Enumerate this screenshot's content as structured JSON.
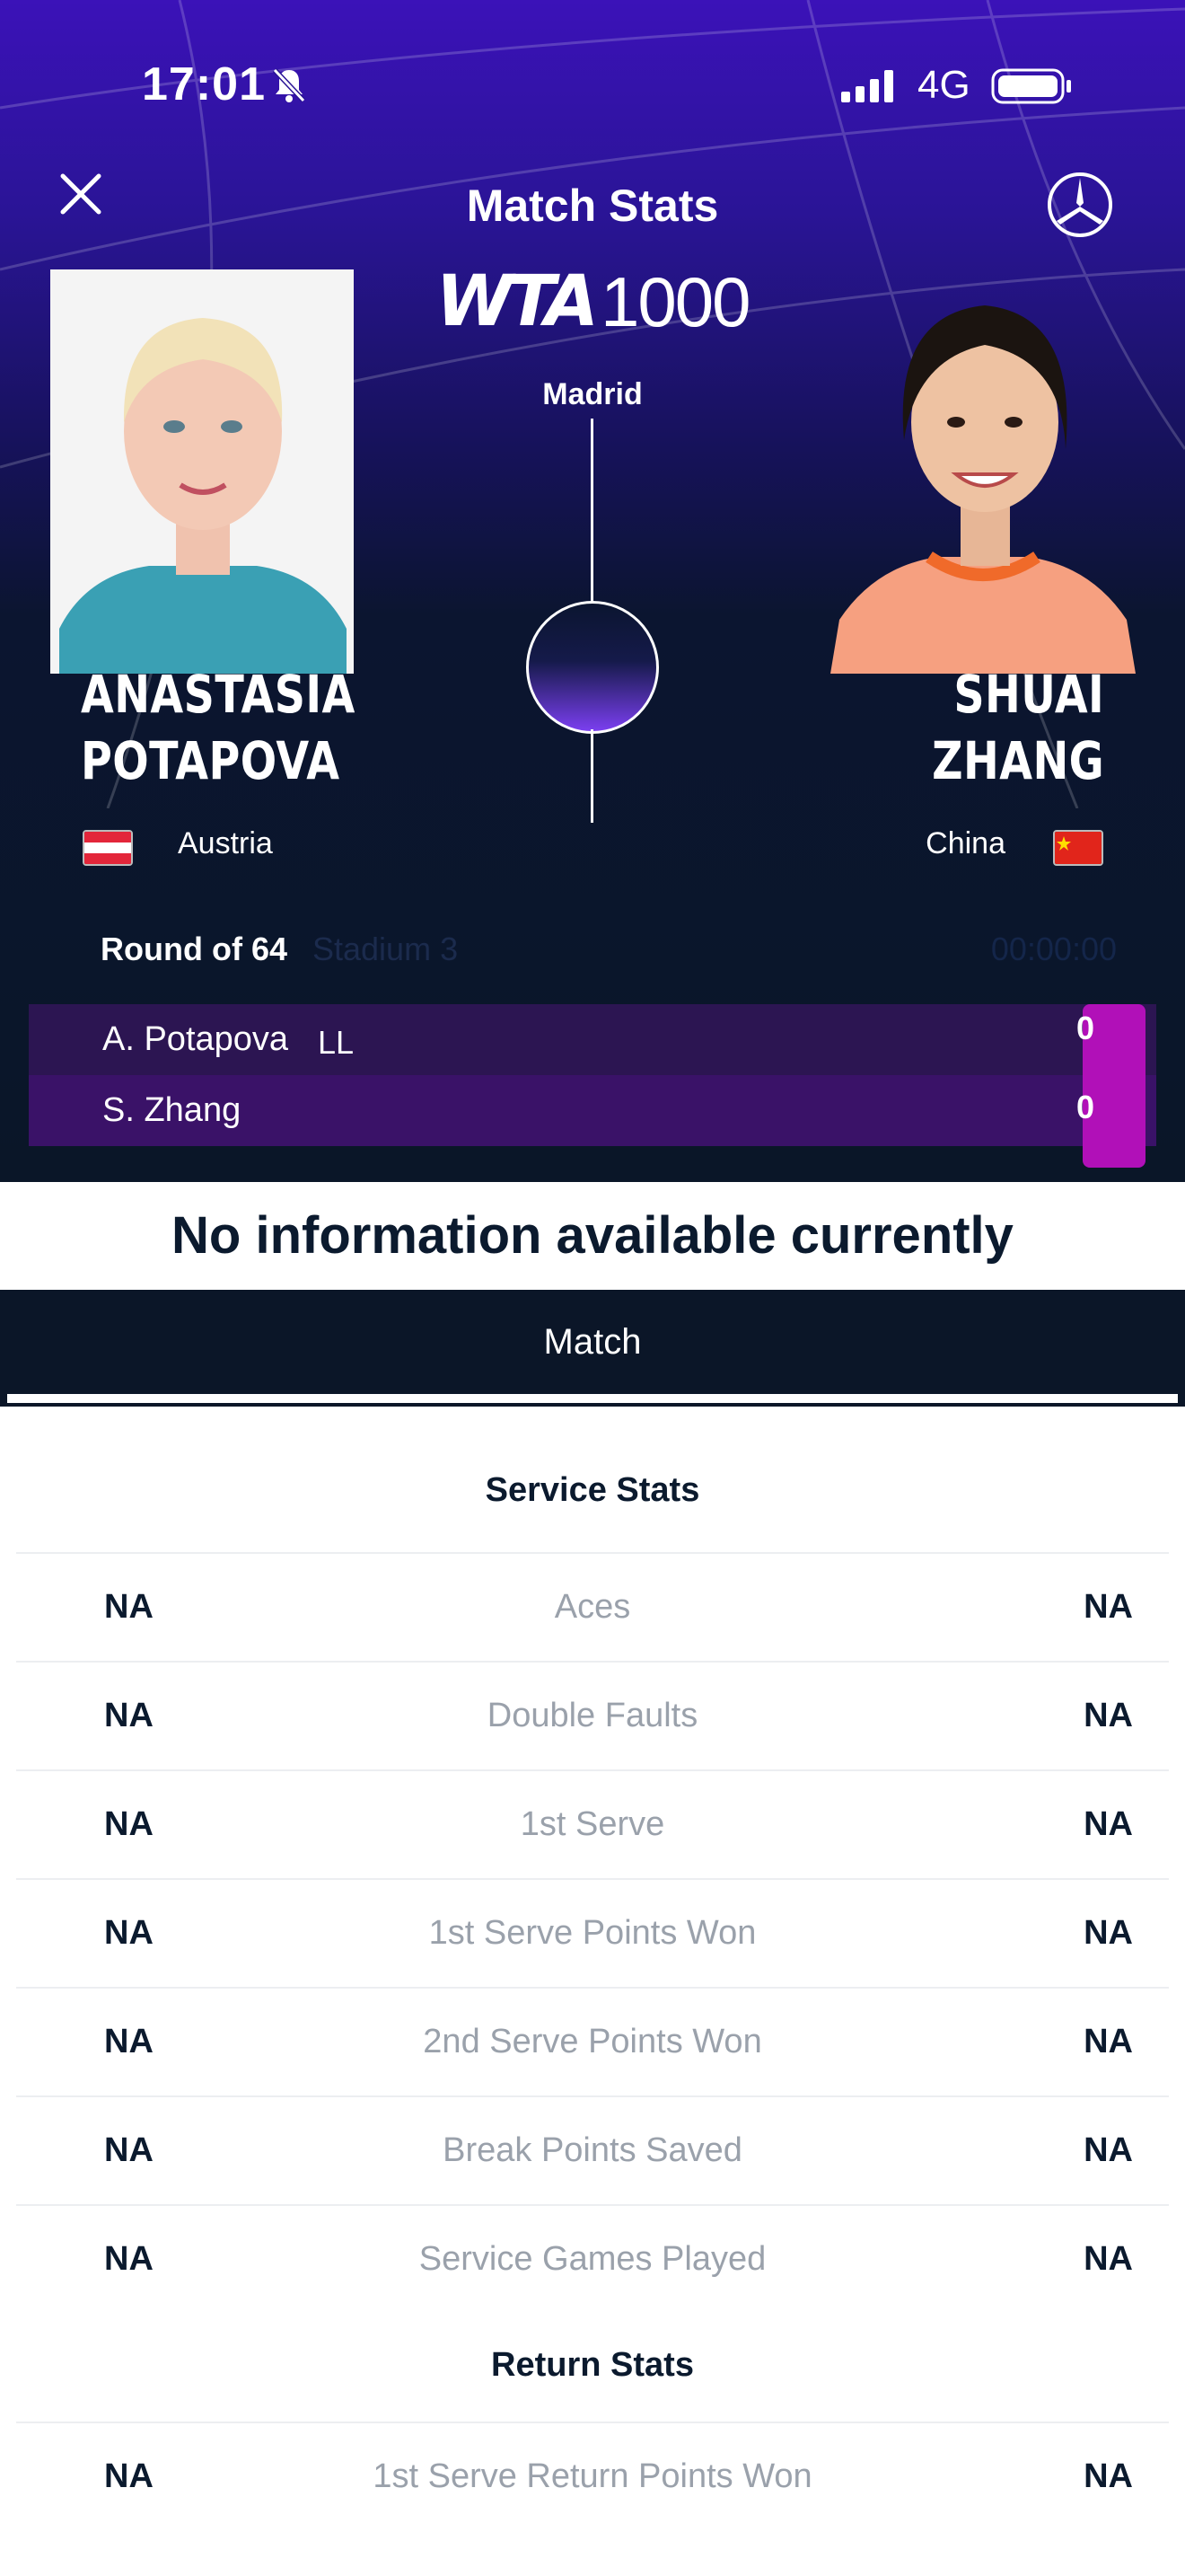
{
  "status_bar": {
    "time": "17:01",
    "network": "4G"
  },
  "header": {
    "title": "Match Stats",
    "logo_main": "WTA",
    "logo_tier": "1000",
    "city": "Madrid"
  },
  "players": {
    "left": {
      "first_name": "ANASTASIA",
      "last_name": "POTAPOVA",
      "country": "Austria",
      "flag": "austria-flag"
    },
    "right": {
      "first_name": "SHUAI",
      "last_name": "ZHANG",
      "country": "China",
      "flag": "china-flag"
    }
  },
  "match_info": {
    "round": "Round of 64",
    "court": "Stadium 3",
    "duration": "00:00:00"
  },
  "scoreboard": [
    {
      "name": "A. Potapova",
      "tag": "LL",
      "score": "0"
    },
    {
      "name": "S. Zhang",
      "tag": "",
      "score": "0"
    }
  ],
  "notice": "No information available currently",
  "tabs": {
    "active": "Match"
  },
  "service_stats": {
    "title": "Service Stats",
    "rows": [
      {
        "left": "NA",
        "label": "Aces",
        "right": "NA"
      },
      {
        "left": "NA",
        "label": "Double Faults",
        "right": "NA"
      },
      {
        "left": "NA",
        "label": "1st Serve",
        "right": "NA"
      },
      {
        "left": "NA",
        "label": "1st Serve Points Won",
        "right": "NA"
      },
      {
        "left": "NA",
        "label": "2nd Serve Points Won",
        "right": "NA"
      },
      {
        "left": "NA",
        "label": "Break Points Saved",
        "right": "NA"
      },
      {
        "left": "NA",
        "label": "Service Games Played",
        "right": "NA"
      }
    ]
  },
  "return_stats": {
    "title": "Return Stats",
    "rows": [
      {
        "left": "NA",
        "label": "1st Serve Return Points Won",
        "right": "NA"
      }
    ]
  },
  "colors": {
    "brand_purple": "#3b12b8",
    "dark_navy": "#0b1628",
    "score_magenta": "#b110b8",
    "label_gray": "#9aa1ab"
  },
  "icons": [
    "bell-muted-icon",
    "signal-icon",
    "battery-icon",
    "close-icon",
    "mercedes-star-icon"
  ]
}
